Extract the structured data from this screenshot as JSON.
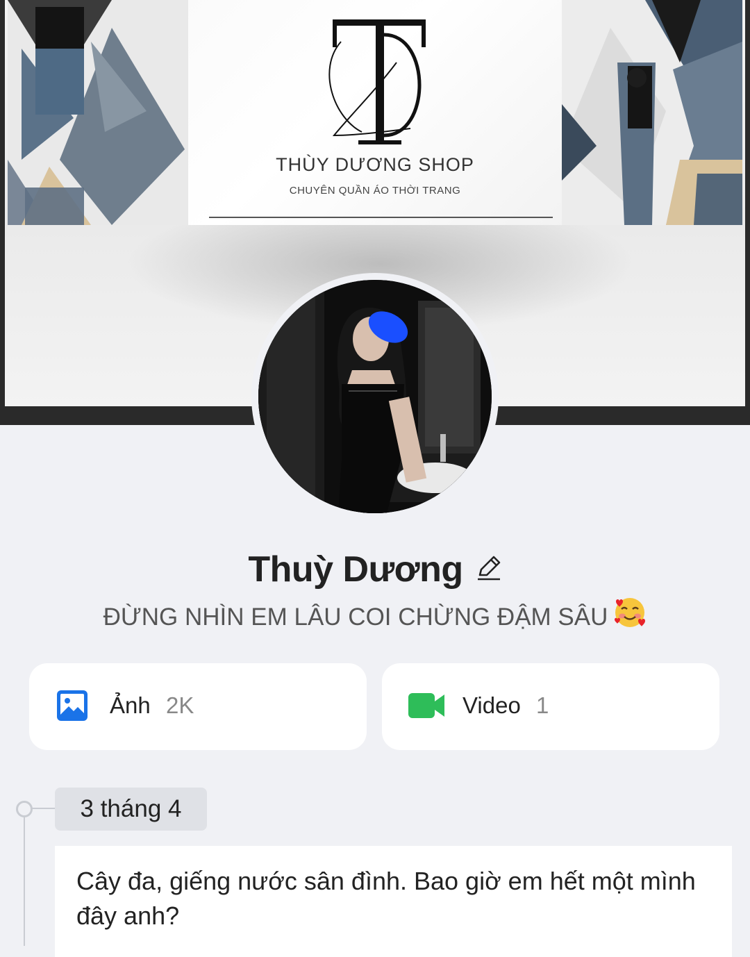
{
  "cover": {
    "shop_name": "THÙY DƯƠNG SHOP",
    "shop_tagline": "CHUYÊN QUẦN ÁO THỜI TRANG",
    "logo_letters": "TD",
    "colors": {
      "frame": "#2a2a2a",
      "background": "#f0f1f5"
    }
  },
  "profile": {
    "name": "Thuỳ Dương",
    "edit_icon": "pencil-icon",
    "status": "ĐỪNG NHÌN EM LÂU COI CHỪNG ĐẬM SÂU",
    "status_emoji": "smiling-face-with-hearts"
  },
  "media": {
    "photos": {
      "label": "Ảnh",
      "count": "2K",
      "icon": "image-icon",
      "color": "#1a73e8"
    },
    "videos": {
      "label": "Video",
      "count": "1",
      "icon": "video-camera-icon",
      "color": "#2ebd59"
    }
  },
  "timeline": {
    "date": "3 tháng 4",
    "post_text": "Cây đa, giếng nước sân đình. Bao giờ em hết một mình đây anh?"
  }
}
